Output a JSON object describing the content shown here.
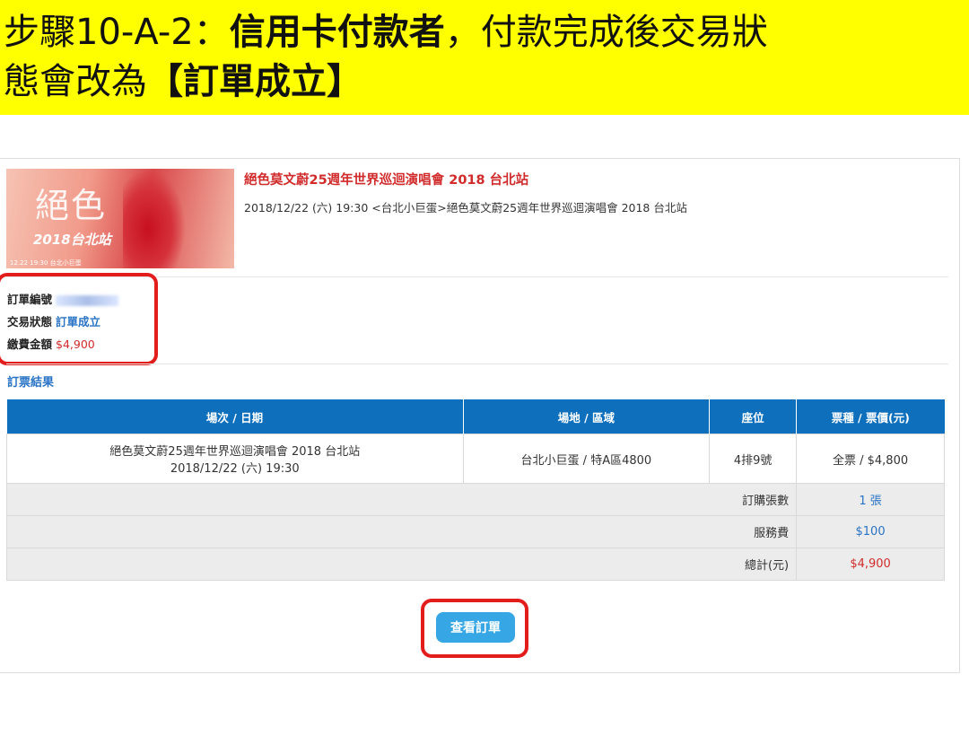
{
  "banner": {
    "line1_prefix": "步驟10-A-2：",
    "line1_bold": "信用卡付款者",
    "line1_suffix": "，付款完成後交易狀",
    "line2_prefix": "態會改為",
    "line2_bold": "【訂單成立】"
  },
  "event": {
    "title": "絕色莫文蔚25週年世界巡迴演唱會 2018 台北站",
    "subtitle": "2018/12/22 (六) 19:30 <台北小巨蛋>絕色莫文蔚25週年世界巡迴演唱會 2018 台北站",
    "poster": {
      "logo": "絕色",
      "city": "2018台北站",
      "date": "12.22 19:30 台北小巨蛋"
    }
  },
  "order": {
    "number_label": "訂單編號",
    "status_label": "交易狀態",
    "status_value": "訂單成立",
    "amount_label": "繳費金額",
    "amount_value": "$4,900"
  },
  "result": {
    "section_title": "訂票結果",
    "headers": [
      "場次 / 日期",
      "場地 / 區域",
      "座位",
      "票種 / 票價(元)"
    ],
    "row": {
      "session_title": "絕色莫文蔚25週年世界巡迴演唱會 2018 台北站",
      "session_date": "2018/12/22 (六) 19:30",
      "venue": "台北小巨蛋 / 特A區4800",
      "seat": "4排9號",
      "ticket": "全票 / $4,800"
    },
    "summary": [
      {
        "label": "訂購張數",
        "value": "1 張"
      },
      {
        "label": "服務費",
        "value": "$100"
      },
      {
        "label": "總計(元)",
        "value": "$4,900"
      }
    ]
  },
  "actions": {
    "view_order": "查看訂單"
  },
  "colors": {
    "banner": "#ffff00",
    "table_header": "#0e6fbd",
    "button": "#37a6e4",
    "highlight_ring": "#e31c1c"
  }
}
